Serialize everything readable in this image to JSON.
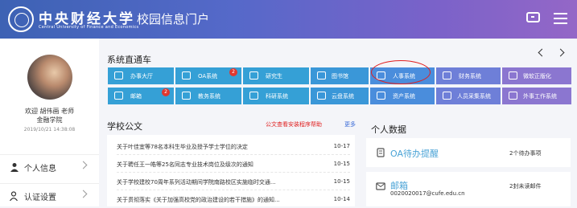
{
  "header": {
    "logo_cn": "中央财经大学",
    "logo_en": "Central University of Finance and Economics",
    "portal_title": "校园信息门户",
    "icons": [
      "message-icon",
      "menu-icon"
    ]
  },
  "user": {
    "welcome": "欢迎 胡伟画 老师",
    "dept": "金融学院",
    "datetime": "2019/10/21 14:38:08"
  },
  "sidebar": {
    "items": [
      {
        "label": "个人信息",
        "icon": "person-icon"
      },
      {
        "label": "认证设置",
        "icon": "person-settings-icon"
      }
    ]
  },
  "direct": {
    "title": "系统直通车",
    "tiles": [
      {
        "label": "办事大厅",
        "icon": "hall-icon",
        "color": "#35a0d6"
      },
      {
        "label": "OA系统",
        "icon": "oa-icon",
        "color": "#35a0d6",
        "badge": "2"
      },
      {
        "label": "研究生",
        "icon": "graduate-cap-icon",
        "color": "#35a0d6"
      },
      {
        "label": "图书馆",
        "icon": "book-icon",
        "color": "#3a97d8"
      },
      {
        "label": "人事系统",
        "icon": "person-icon",
        "color": "#4a8ddc"
      },
      {
        "label": "财务系统",
        "icon": "finance-icon",
        "color": "#6e7fd8"
      },
      {
        "label": "微软正版化",
        "icon": "windows-icon",
        "color": "#8b76d0"
      },
      {
        "label": "邮箱",
        "icon": "mail-icon",
        "color": "#35a0d6",
        "badge": "2"
      },
      {
        "label": "教务系统",
        "icon": "monitor-icon",
        "color": "#35a0d6"
      },
      {
        "label": "科研系统",
        "icon": "microscope-icon",
        "color": "#35a0d6"
      },
      {
        "label": "云盘系统",
        "icon": "cloud-disk-icon",
        "color": "#3a97d8"
      },
      {
        "label": "资产系统",
        "icon": "asset-icon",
        "color": "#4a8ddc"
      },
      {
        "label": "人员采集系统",
        "icon": "people-icon",
        "color": "#6e7fd8"
      },
      {
        "label": "外事工作系统",
        "icon": "foreign-affairs-icon",
        "color": "#8b76d0"
      }
    ]
  },
  "news": {
    "title": "学校公文",
    "notice": "公文查看安装程序帮助",
    "more": "更多",
    "items": [
      {
        "title": "关于叶佳宜等78名本科生毕业及授予学士学位的决定",
        "date": "10-17"
      },
      {
        "title": "关于聘任王一皓等25名同志专业技术岗位及级次的通知",
        "date": "10-15"
      },
      {
        "title": "关于学校建校70周年系列活动期间学院南路校区实施临时交通...",
        "date": "10-15"
      },
      {
        "title": "关于贯彻落实《关于加强高校党的政治建设的若干措施》的通知...",
        "date": "10-14"
      }
    ]
  },
  "personal": {
    "title": "个人数据",
    "cards": [
      {
        "name": "OA待办提醒",
        "count": "2个待办事项",
        "icon": "doc-icon"
      },
      {
        "name": "邮箱",
        "sub": "0020020017@cufe.edu.cn",
        "count": "2封未读邮件",
        "icon": "mail-icon"
      }
    ]
  }
}
